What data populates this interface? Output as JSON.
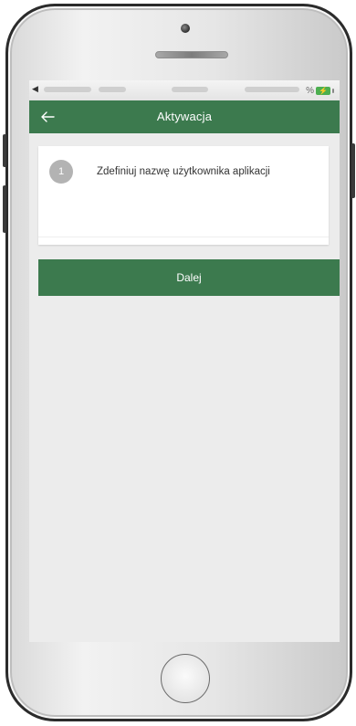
{
  "status_bar": {
    "battery_percent_symbol": "%",
    "battery_icon": "battery-charging-icon"
  },
  "app_bar": {
    "title": "Aktywacja",
    "back_icon": "arrow-left-icon"
  },
  "steps": [
    {
      "number": "1",
      "text": "Zdefiniuj nazwę użytkownika aplikacji"
    }
  ],
  "actions": {
    "next_label": "Dalej"
  },
  "colors": {
    "primary": "#3c7a4e",
    "step_badge": "#b3b3b3",
    "screen_background": "#ececec"
  }
}
